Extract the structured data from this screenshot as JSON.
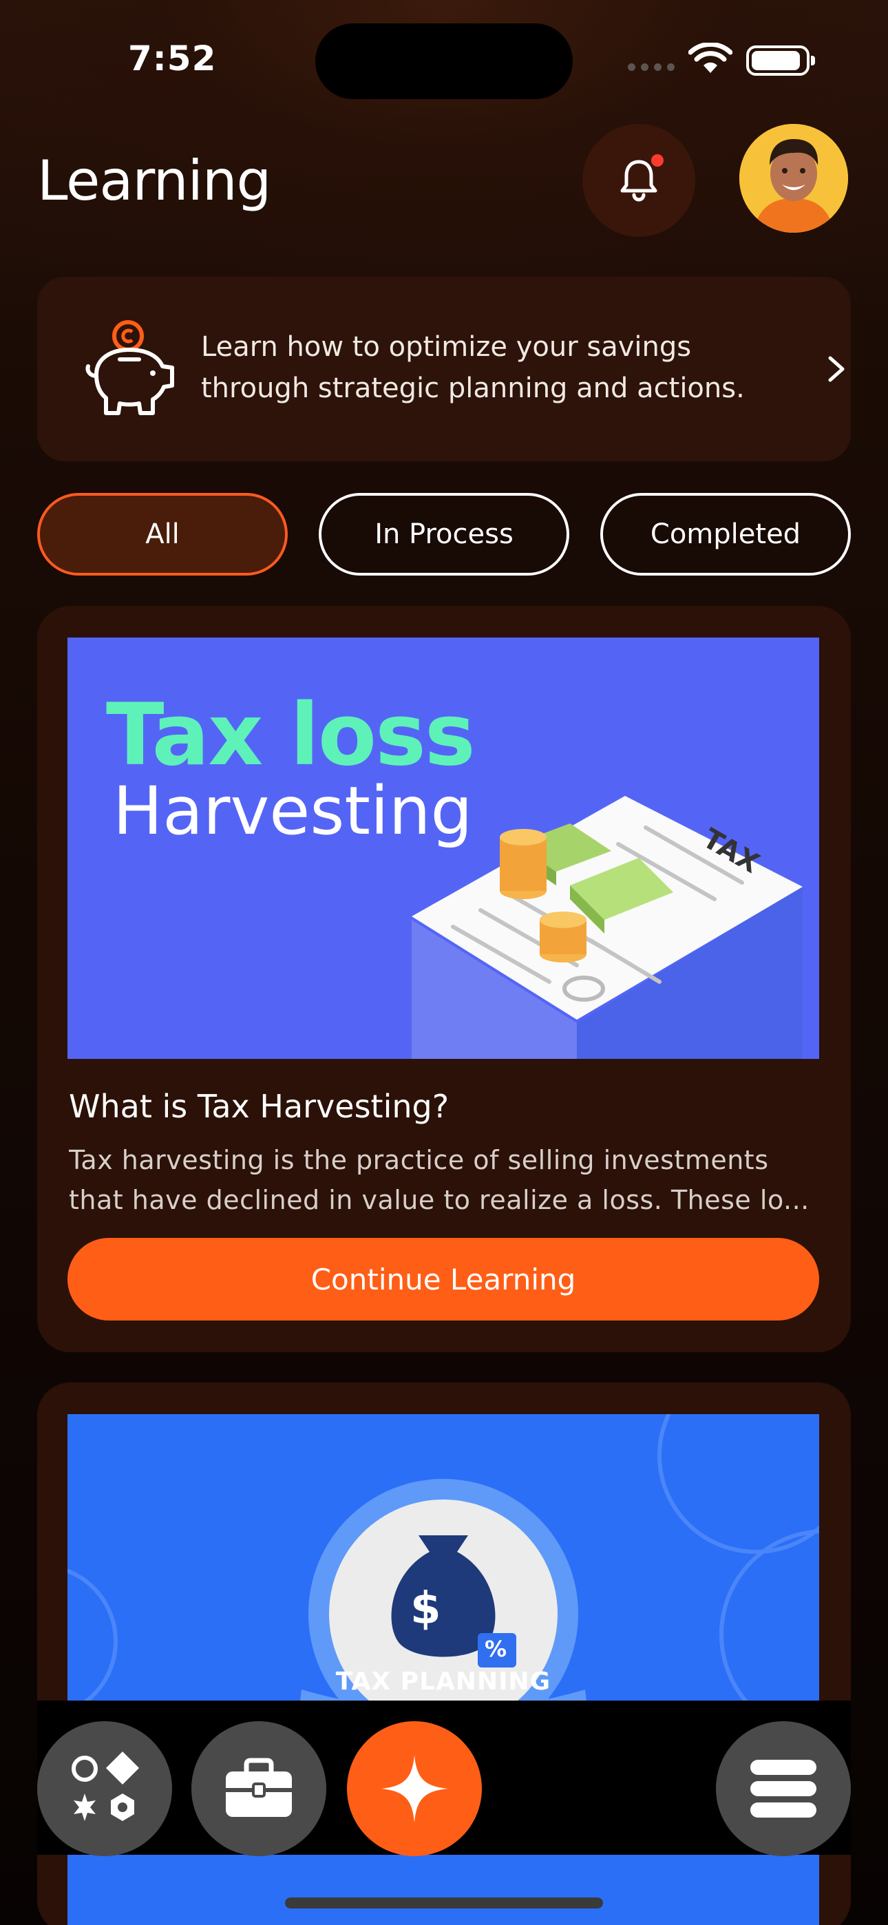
{
  "status_bar": {
    "time": "7:52"
  },
  "header": {
    "title": "Learning"
  },
  "promo": {
    "text": "Learn how to optimize your savings through strategic planning and actions."
  },
  "filters": [
    {
      "label": "All",
      "active": true
    },
    {
      "label": "In Process",
      "active": false
    },
    {
      "label": "Completed",
      "active": false
    }
  ],
  "cards": [
    {
      "banner_line1": "Tax loss",
      "banner_line2": "Harvesting",
      "banner_stamp": "TAX",
      "title": "What is Tax Harvesting?",
      "description": "Tax harvesting is the practice of selling investments that have declined in value to realize a loss. These lo...",
      "cta": "Continue Learning"
    },
    {
      "badge_label": "TAX PLANNING",
      "badge_symbol": "$",
      "badge_percent": "%"
    }
  ],
  "colors": {
    "accent": "#ff5e16",
    "card_bg": "#2b1107",
    "banner1_bg": "#5465f6",
    "banner2_bg": "#2b6ff7",
    "banner_green": "#5ef2b9"
  },
  "bottom_nav": [
    {
      "icon": "apps-icon"
    },
    {
      "icon": "briefcase-icon"
    },
    {
      "icon": "sparkle-icon"
    },
    {
      "icon": "menu-icon"
    }
  ]
}
